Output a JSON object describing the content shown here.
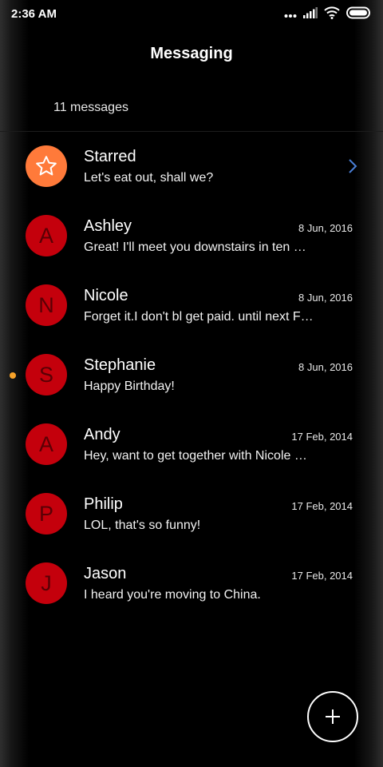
{
  "status_bar": {
    "time": "2:36 AM",
    "icons": [
      "more-dots-icon",
      "signal-icon",
      "wifi-icon",
      "battery-icon"
    ]
  },
  "header": {
    "title": "Messaging"
  },
  "summary": {
    "count_label": "11 messages"
  },
  "threads": [
    {
      "name": "Starred",
      "initial": "",
      "icon": "star-icon",
      "snippet": "Let's eat out, shall we?",
      "date": "",
      "unread": false
    },
    {
      "name": "Ashley",
      "initial": "A",
      "snippet": "Great! I'll meet you downstairs in ten …",
      "date": "8 Jun, 2016",
      "unread": false
    },
    {
      "name": "Nicole",
      "initial": "N",
      "snippet": "Forget it.I don't bl get paid. until next F…",
      "date": "8 Jun, 2016",
      "unread": false
    },
    {
      "name": "Stephanie",
      "initial": "S",
      "snippet": "Happy Birthday!",
      "date": "8 Jun, 2016",
      "unread": true
    },
    {
      "name": "Andy",
      "initial": "A",
      "snippet": "Hey, want to get together with Nicole …",
      "date": "17 Feb, 2014",
      "unread": false
    },
    {
      "name": "Philip",
      "initial": "P",
      "snippet": "LOL, that's so funny!",
      "date": "17 Feb, 2014",
      "unread": false
    },
    {
      "name": "Jason",
      "initial": "J",
      "snippet": "I heard you're moving to China.",
      "date": "17 Feb, 2014",
      "unread": false
    }
  ],
  "colors": {
    "background": "#000000",
    "avatar": "#c4000c",
    "starred_avatar": "#ff7a3a",
    "unread_dot": "#f6a229",
    "chevron": "#4a7fd6"
  },
  "fab": {
    "icon": "plus-icon"
  }
}
